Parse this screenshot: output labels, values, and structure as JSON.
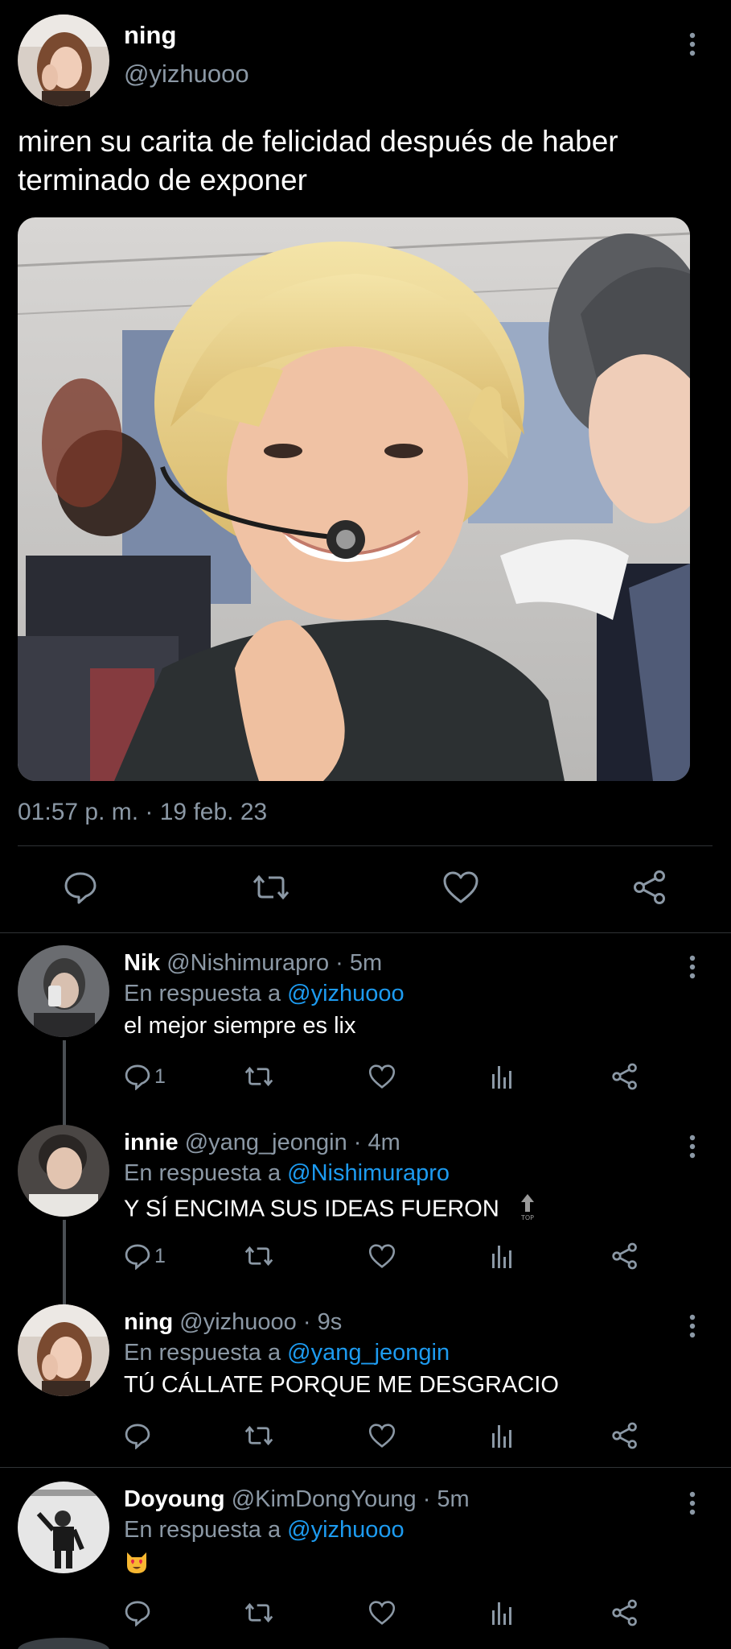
{
  "main_tweet": {
    "author_name": "ning",
    "author_handle": "@yizhuooo",
    "text": "miren su carita de felicidad después de haber terminado de exponer",
    "timestamp": "01:57 p. m. · 19 feb. 23",
    "media_description": "photo",
    "actions": [
      "reply-icon",
      "retweet-icon",
      "like-icon",
      "share-icon"
    ]
  },
  "replies": [
    {
      "name": "Nik",
      "handle": "@Nishimurapro",
      "time": "5m",
      "reply_label": "En respuesta a",
      "reply_to": "@yizhuooo",
      "text": "el mejor siempre es lix",
      "reply_count": "1"
    },
    {
      "name": "innie",
      "handle": "@yang_jeongin",
      "time": "4m",
      "reply_label": "En respuesta a",
      "reply_to": "@Nishimurapro",
      "text": "Y SÍ ENCIMA SUS IDEAS FUERON",
      "reply_count": "1",
      "top_badge": "TOP"
    },
    {
      "name": "ning",
      "handle": "@yizhuooo",
      "time": "9s",
      "reply_label": "En respuesta a",
      "reply_to": "@yang_jeongin",
      "text": "TÚ CÁLLATE PORQUE ME DESGRACIO",
      "reply_count": ""
    },
    {
      "name": "Doyoung",
      "handle": "@KimDongYoung",
      "time": "5m",
      "reply_label": "En respuesta a",
      "reply_to": "@yizhuooo",
      "text": "",
      "emoji": "heart-eyes-cat",
      "reply_count": ""
    }
  ],
  "colors": {
    "background": "#000000",
    "text": "#e7e9ea",
    "muted": "#8b98a5",
    "link": "#1d9bf0",
    "divider": "#2f3336"
  }
}
